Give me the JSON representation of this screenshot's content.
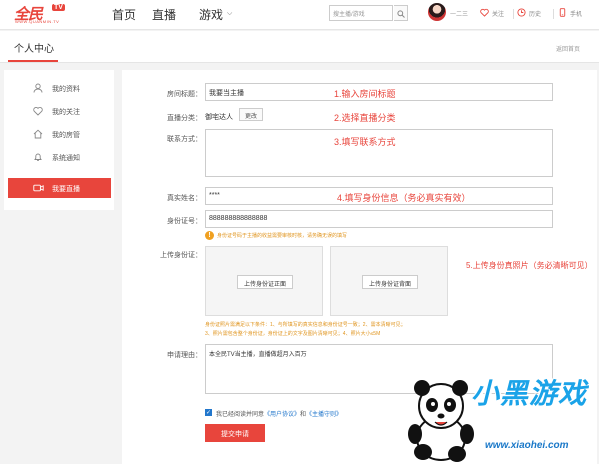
{
  "header": {
    "logo_text": "全民",
    "logo_tv": "TV",
    "logo_sub": "WWW.QUANMIN.TV",
    "nav": {
      "home": "首页",
      "live": "直播",
      "game": "游戏"
    },
    "search_placeholder": "搜主播/游戏",
    "username": "一二三",
    "follow": "关注",
    "history": "历史",
    "phone": "手机"
  },
  "page": {
    "title": "个人中心",
    "back": "返回首页"
  },
  "sidebar": {
    "items": [
      {
        "label": "我的资料",
        "icon": "user-icon"
      },
      {
        "label": "我的关注",
        "icon": "heart-icon"
      },
      {
        "label": "我的房管",
        "icon": "home-icon"
      },
      {
        "label": "系统通知",
        "icon": "bell-icon"
      },
      {
        "label": "我要直播",
        "icon": "camera-icon",
        "active": true
      }
    ]
  },
  "form": {
    "room_title_label": "房间标题：",
    "room_title_value": "我要当主播",
    "room_title_note": "1.输入房间标题",
    "category_label": "直播分类：",
    "category_value": "御宅达人",
    "category_change": "更改",
    "category_note": "2.选择直播分类",
    "contact_label": "联系方式：",
    "contact_note": "3.填写联系方式",
    "realname_label": "真实姓名：",
    "realname_value": "****",
    "id_note": "4.填写身份信息（务必真实有效）",
    "idnum_label": "身份证号：",
    "idnum_value": "888888888888888",
    "id_warning": "身份证号码于主播的收益需要审核时核，请务确无误的填写",
    "upload_label": "上传身份证：",
    "upload_front": "上传身份证正面",
    "upload_back": "上传身份证背面",
    "upload_note": "5.上传身份真照片（务必清晰可见）",
    "upload_req_1": "身份证照片需满足以下条件：1、与所填写的真实信息和身份证号一致；2、需本清晰可见；",
    "upload_req_2": "3、照片需包含整个身份证，身份证上的文字及图片清晰可见；4、照片大小≤5M",
    "reason_label": "申请理由：",
    "reason_value": "本全民TV当主播，直播做超月入百万",
    "agree_prefix": "我已经阅读并同意",
    "agree_link1": "《用户协议》",
    "agree_mid": "和",
    "agree_link2": "《主播守则》",
    "submit": "提交申请"
  },
  "watermark": {
    "title": "小黑游戏",
    "url": "www.xiaohei.com"
  },
  "colors": {
    "accent": "#e8453c",
    "link": "#2277cc",
    "warn": "#e0951f",
    "watermark": "#1aa3e8"
  }
}
